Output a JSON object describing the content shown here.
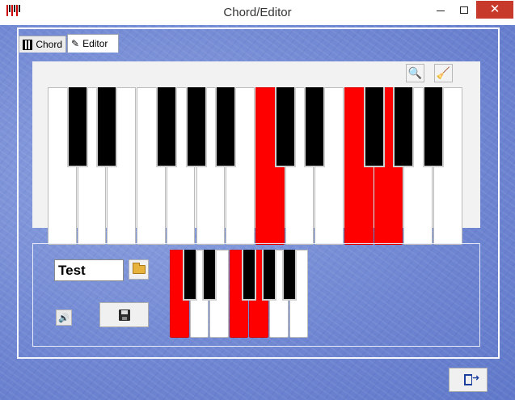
{
  "window": {
    "title": "Chord/Editor",
    "minimize_label": "",
    "close_label": "✕"
  },
  "tabs": [
    {
      "label": "Chord",
      "icon": "piano-icon"
    },
    {
      "label": "Editor",
      "icon": "pen-icon"
    }
  ],
  "toolbar": {
    "find_icon": "binoculars-icon",
    "clear_icon": "broom-icon",
    "find_glyph": "🔍",
    "clear_glyph": "🧹"
  },
  "big_keyboard": {
    "white_keys": [
      false,
      false,
      false,
      false,
      false,
      false,
      false,
      true,
      false,
      false,
      true,
      true,
      false,
      false
    ],
    "black_keys": [
      {
        "after_white": 0,
        "on": false
      },
      {
        "after_white": 1,
        "on": false
      },
      {
        "after_white": 3,
        "on": false
      },
      {
        "after_white": 4,
        "on": false
      },
      {
        "after_white": 5,
        "on": false
      },
      {
        "after_white": 7,
        "on": false
      },
      {
        "after_white": 8,
        "on": false
      },
      {
        "after_white": 10,
        "on": false
      },
      {
        "after_white": 11,
        "on": false
      },
      {
        "after_white": 12,
        "on": false
      }
    ],
    "highlight_color": "#ff0000"
  },
  "chord_editor": {
    "name_value": "Test",
    "speaker_glyph": "🔊",
    "small_keyboard": {
      "white_keys": [
        true,
        false,
        false,
        true,
        true,
        false,
        false
      ],
      "black_keys": [
        {
          "after_white": 0,
          "on": false
        },
        {
          "after_white": 1,
          "on": false
        },
        {
          "after_white": 3,
          "on": false
        },
        {
          "after_white": 4,
          "on": false
        },
        {
          "after_white": 5,
          "on": false
        }
      ]
    }
  }
}
